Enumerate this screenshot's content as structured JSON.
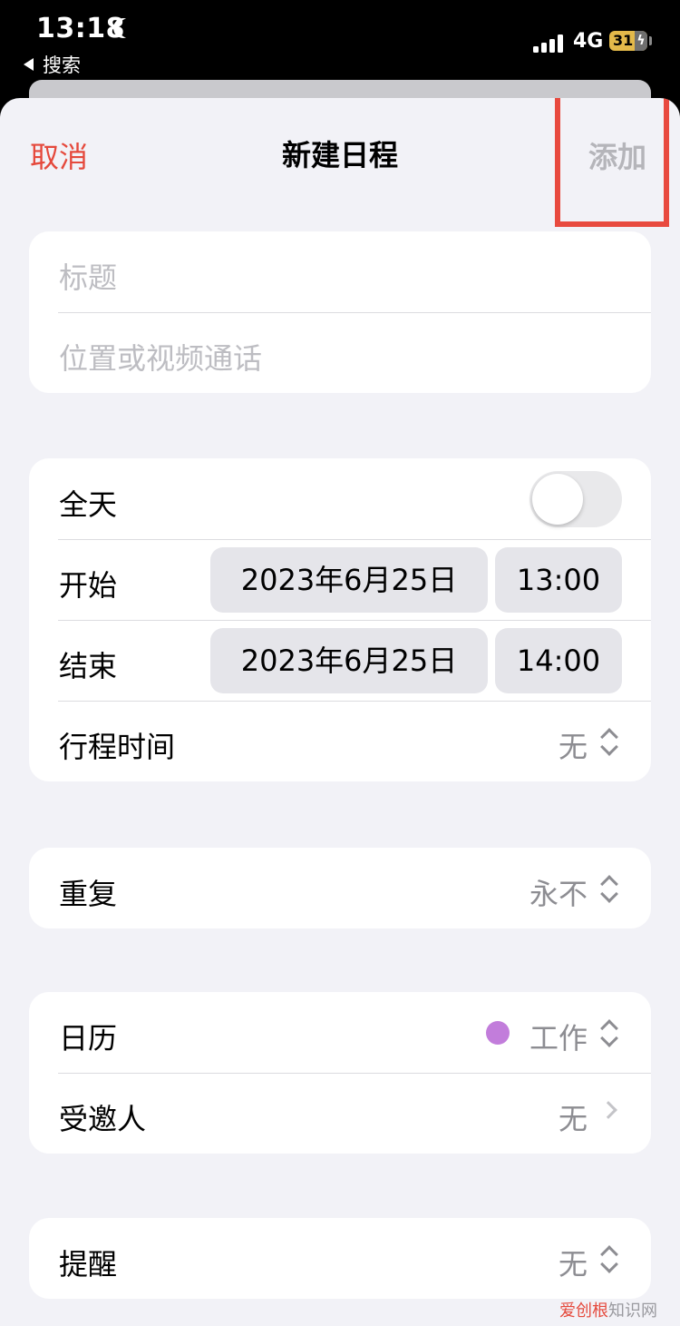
{
  "status_bar": {
    "time": "13:18",
    "back_app": "搜索",
    "network": "4G",
    "battery": "31"
  },
  "nav": {
    "cancel": "取消",
    "title": "新建日程",
    "add": "添加"
  },
  "details": {
    "title_placeholder": "标题",
    "location_placeholder": "位置或视频通话"
  },
  "time_group": {
    "all_day_label": "全天",
    "all_day_on": false,
    "start_label": "开始",
    "start_date": "2023年6月25日",
    "start_time": "13:00",
    "end_label": "结束",
    "end_date": "2023年6月25日",
    "end_time": "14:00",
    "travel_label": "行程时间",
    "travel_value": "无"
  },
  "repeat": {
    "label": "重复",
    "value": "永不"
  },
  "calendar_group": {
    "calendar_label": "日历",
    "calendar_value": "工作",
    "calendar_color": "#c27ddb",
    "invitees_label": "受邀人",
    "invitees_value": "无"
  },
  "alert": {
    "label": "提醒",
    "value": "无"
  },
  "colors": {
    "accent_red": "#e5493c",
    "highlight_box": "#e84a3f",
    "battery": "#e3b94a"
  },
  "watermark": {
    "brand": "爱创根",
    "suffix": "知识网"
  }
}
